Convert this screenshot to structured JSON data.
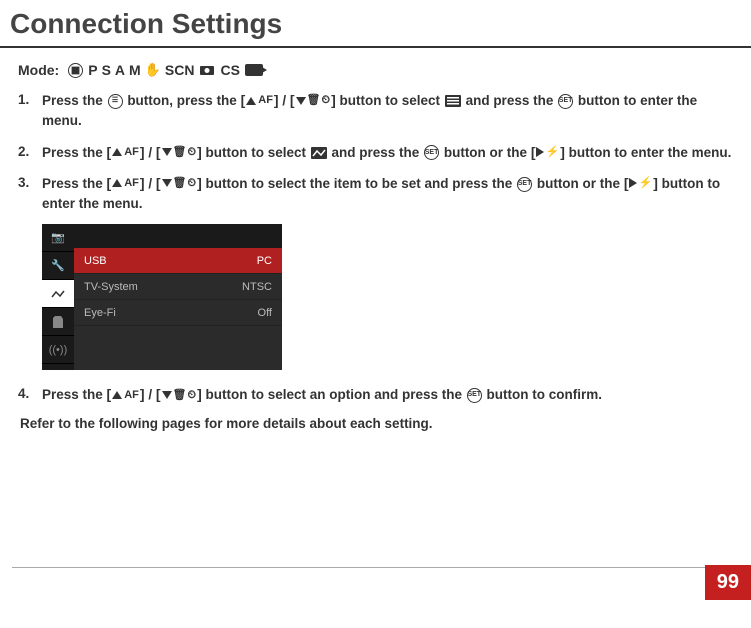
{
  "title": "Connection Settings",
  "mode_label": "Mode:",
  "mode_glyphs": {
    "p": "P",
    "s": "S",
    "a": "A",
    "m": "M",
    "scn": "SCN",
    "cs": "CS"
  },
  "steps": {
    "s1": {
      "t1": "Press the ",
      "t2": " button, press the ",
      "t3": " / ",
      "t4": " button to select ",
      "t5": " and press the ",
      "t6": " button to enter the menu.",
      "af": "AF",
      "set": "SET"
    },
    "s2": {
      "t1": "Press the ",
      "t2": " / ",
      "t3": " button to select ",
      "t4": " and press the ",
      "t5": " button or the ",
      "t6": " button to enter the menu.",
      "af": "AF",
      "set": "SET"
    },
    "s3": {
      "t1": "Press the ",
      "t2": " / ",
      "t3": " button to select the item to be set and press the ",
      "t4": " button or the ",
      "t5": " button to enter the menu.",
      "af": "AF",
      "set": "SET"
    },
    "s4": {
      "t1": "Press the ",
      "t2": " / ",
      "t3": " button to select an option and press the ",
      "t4": " button to confirm.",
      "af": "AF",
      "set": "SET"
    }
  },
  "menu": {
    "rows": [
      {
        "label": "USB",
        "value": "PC"
      },
      {
        "label": "TV-System",
        "value": "NTSC"
      },
      {
        "label": "Eye-Fi",
        "value": "Off"
      }
    ]
  },
  "refer_text": "Refer to the following pages for more details about each setting.",
  "page_number": "99"
}
